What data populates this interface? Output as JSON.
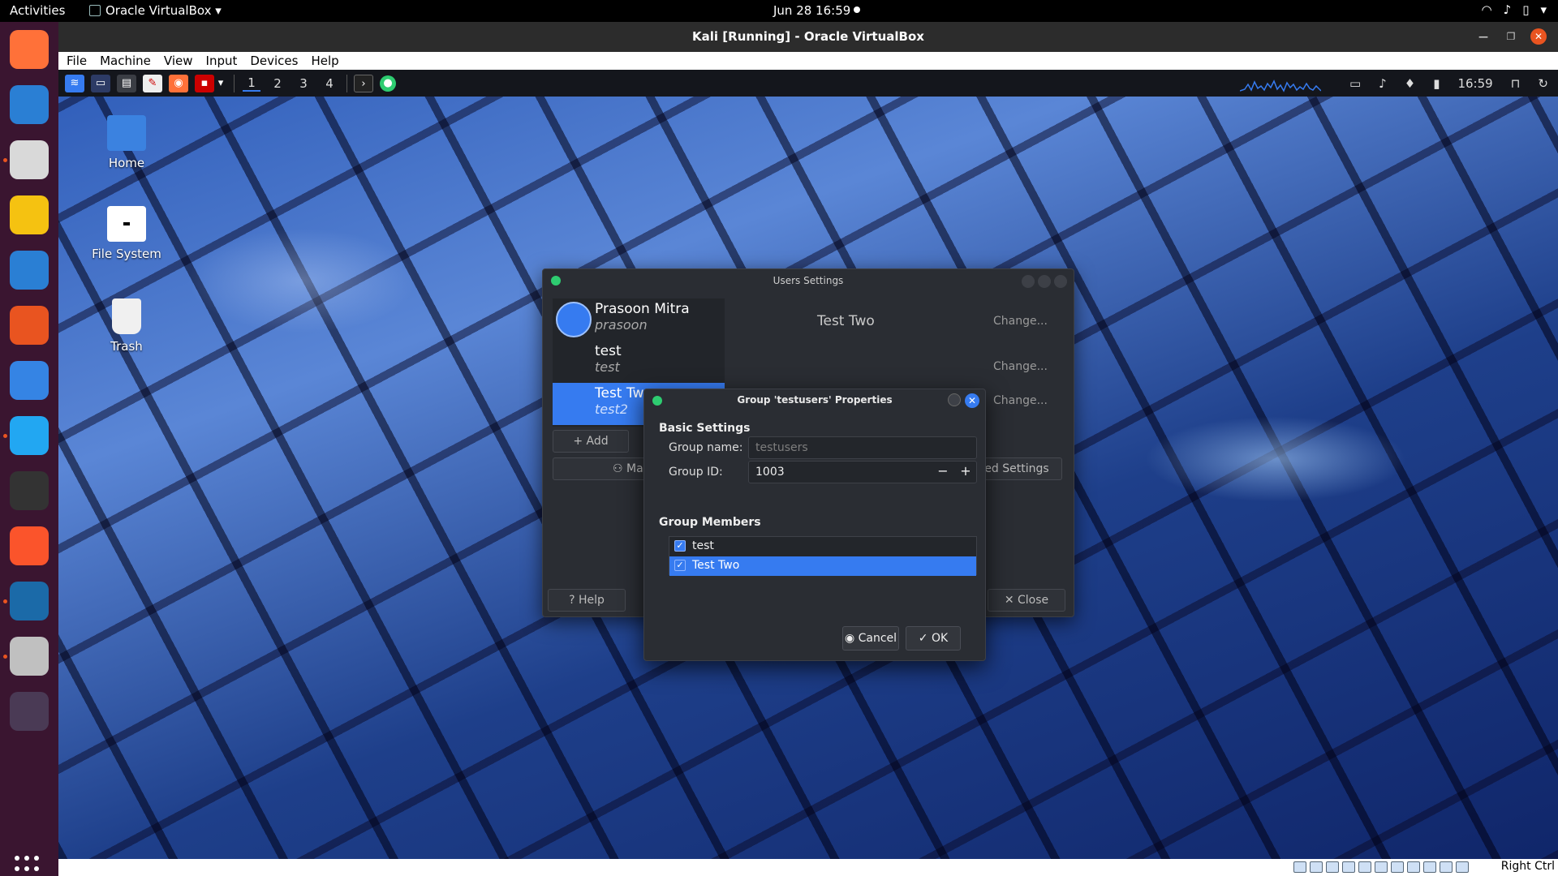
{
  "gnome_topbar": {
    "activities": "Activities",
    "app_menu": "Oracle VirtualBox ▾",
    "clock": "Jun 28  16:59",
    "tray_icons": [
      "wifi-icon",
      "volume-icon",
      "battery-icon",
      "power-menu-icon"
    ]
  },
  "dock": {
    "items": [
      {
        "name": "firefox-icon",
        "color": "#ff7139",
        "running": false
      },
      {
        "name": "thunderbird-icon",
        "color": "#2a7fd4",
        "running": false
      },
      {
        "name": "files-icon",
        "color": "#d9d9d9",
        "running": true
      },
      {
        "name": "rhythmbox-icon",
        "color": "#f5c211",
        "running": false
      },
      {
        "name": "libreoffice-writer-icon",
        "color": "#2a7fd4",
        "running": false
      },
      {
        "name": "software-center-icon",
        "color": "#e95420",
        "running": false
      },
      {
        "name": "help-icon",
        "color": "#3584e4",
        "running": false
      },
      {
        "name": "vscode-icon",
        "color": "#22a7f2",
        "running": true
      },
      {
        "name": "terminal-icon",
        "color": "#333333",
        "running": false
      },
      {
        "name": "brave-icon",
        "color": "#fb542b",
        "running": false
      },
      {
        "name": "virtualbox-icon",
        "color": "#1b6aa8",
        "running": true
      },
      {
        "name": "image-viewer-icon",
        "color": "#c0c0c0",
        "running": true
      },
      {
        "name": "virtualbox-vm-icon",
        "color": "#4a3a55",
        "running": false
      }
    ]
  },
  "vbox": {
    "title": "Kali [Running] - Oracle VirtualBox",
    "menu": [
      "File",
      "Machine",
      "View",
      "Input",
      "Devices",
      "Help"
    ],
    "host_key": "Right Ctrl"
  },
  "kali_panel": {
    "workspaces": [
      "1",
      "2",
      "3",
      "4"
    ],
    "clock": "16:59"
  },
  "desktop_icons": [
    {
      "label": "Home"
    },
    {
      "label": "File System"
    },
    {
      "label": "Trash"
    }
  ],
  "users_settings": {
    "title": "Users Settings",
    "users": [
      {
        "name": "Prasoon Mitra",
        "login": "prasoon",
        "selected": false
      },
      {
        "name": "test",
        "login": "test",
        "selected": false
      },
      {
        "name": "Test Tw",
        "login": "test2",
        "selected": true
      }
    ],
    "selected_full_name": "Test Two",
    "change_label": "Change...",
    "add_label": "Add",
    "manage_label": "Manag",
    "advanced_label": "ed Settings",
    "help_label": "Help",
    "close_label": "Close"
  },
  "group_dialog": {
    "title": "Group 'testusers' Properties",
    "basic_settings": "Basic Settings",
    "group_name_label": "Group name:",
    "group_name_value": "testusers",
    "group_id_label": "Group ID:",
    "group_id_value": "1003",
    "members_heading": "Group Members",
    "members": [
      {
        "name": "test",
        "checked": true,
        "selected": false
      },
      {
        "name": "Test Two",
        "checked": true,
        "selected": true
      }
    ],
    "cancel_label": "Cancel",
    "ok_label": "OK"
  },
  "colors": {
    "accent": "#367bf0",
    "ubuntu_orange": "#e95420",
    "dock_bg": "#3a1530"
  }
}
